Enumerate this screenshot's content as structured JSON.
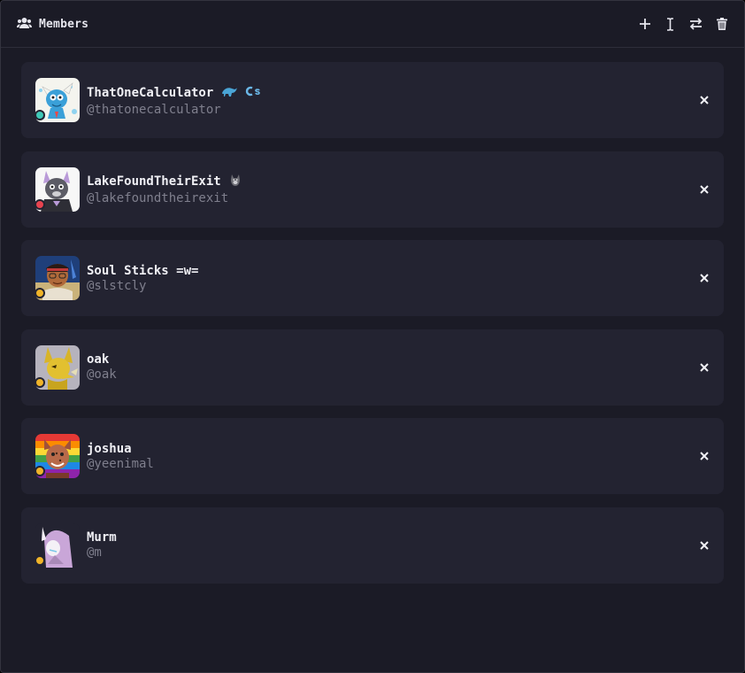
{
  "header": {
    "title": "Members",
    "icon": "users-icon",
    "actions": [
      {
        "name": "add-member-button",
        "icon": "plus-icon"
      },
      {
        "name": "text-cursor-button",
        "icon": "text-cursor-icon"
      },
      {
        "name": "transfer-button",
        "icon": "swap-arrows-icon"
      },
      {
        "name": "delete-button",
        "icon": "trash-icon"
      }
    ]
  },
  "colors": {
    "background": "#1b1b26",
    "card": "#232331",
    "status_online": "#3fc9b8",
    "status_dnd": "#e8434f",
    "status_idle": "#f0b429"
  },
  "members": [
    {
      "display_name": "ThatOneCalculator",
      "handle": "@thatonecalculator",
      "status": "online",
      "emojis": [
        "dinosaur-emoji",
        "cs-badge-emoji"
      ]
    },
    {
      "display_name": "LakeFoundTheirExit",
      "handle": "@lakefoundtheirexit",
      "status": "dnd",
      "emojis": [
        "wolf-emoji"
      ]
    },
    {
      "display_name": "Soul Sticks =w=",
      "handle": "@slstcly",
      "status": "idle",
      "emojis": []
    },
    {
      "display_name": "oak",
      "handle": "@oak",
      "status": "idle",
      "emojis": []
    },
    {
      "display_name": "joshua",
      "handle": "@yeenimal",
      "status": "idle",
      "emojis": []
    },
    {
      "display_name": "Murm",
      "handle": "@m",
      "status": "idle",
      "emojis": []
    }
  ]
}
